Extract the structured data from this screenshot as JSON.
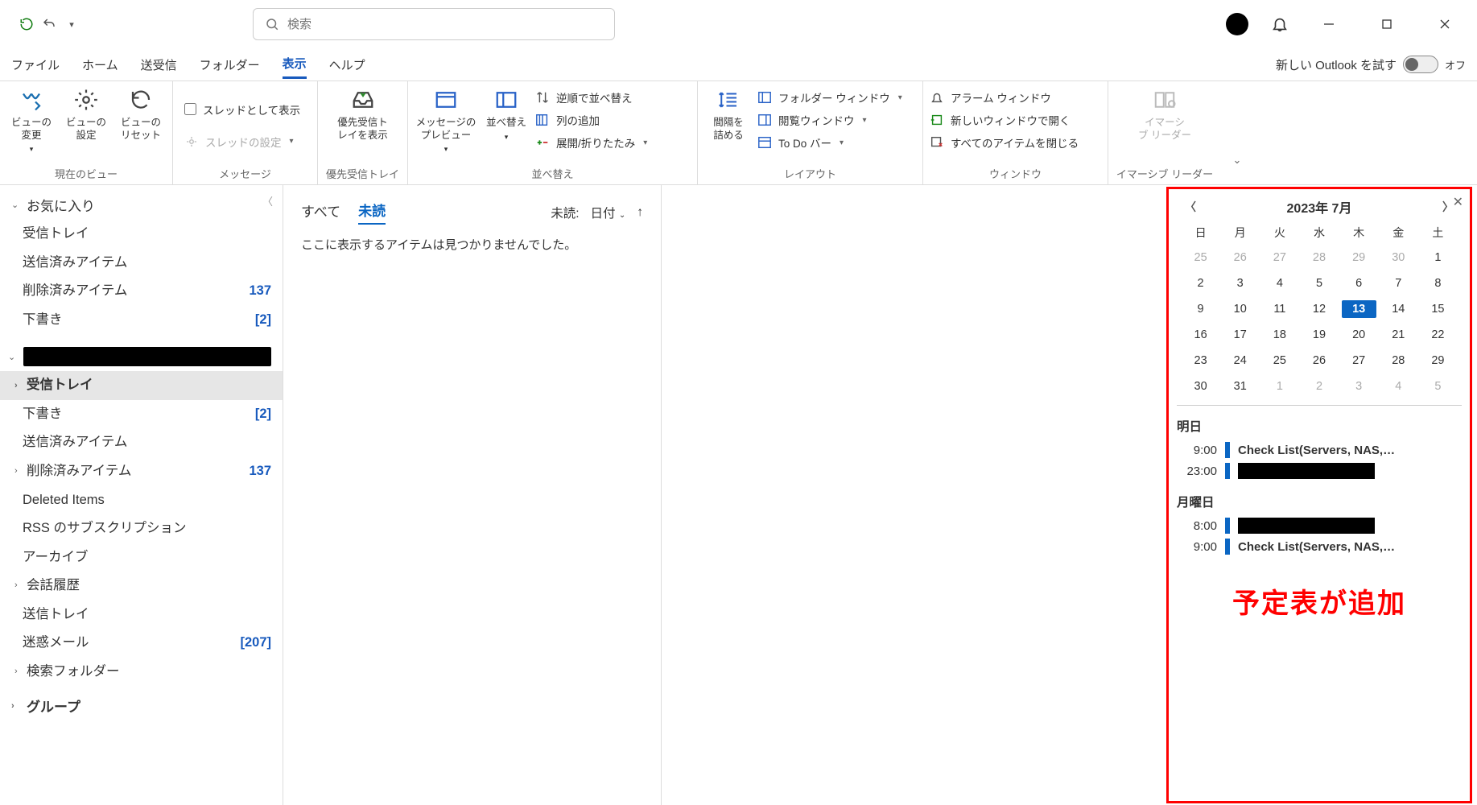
{
  "search": {
    "placeholder": "検索"
  },
  "titlebar": {
    "tryNewOutlook": "新しい Outlook を試す",
    "toggle": "オフ"
  },
  "tabs": [
    "ファイル",
    "ホーム",
    "送受信",
    "フォルダー",
    "表示",
    "ヘルプ"
  ],
  "activeTab": "表示",
  "ribbon": {
    "g1": {
      "label": "現在のビュー",
      "btn1": "ビューの\n変更",
      "btn2": "ビューの\n設定",
      "btn3": "ビューの\nリセット"
    },
    "g2": {
      "label": "メッセージ",
      "thread": "スレッドとして表示",
      "settings": "スレッドの設定"
    },
    "g3": {
      "label": "優先受信トレイ",
      "btn": "優先受信ト\nレイを表示"
    },
    "g4": {
      "label": "並べ替え",
      "preview": "メッセージの\nプレビュー",
      "sort": "並べ替え",
      "reverse": "逆順で並べ替え",
      "addcol": "列の追加",
      "expand": "展開/折りたたみ"
    },
    "g5": {
      "label": "レイアウト",
      "space": "間隔を\n詰める",
      "folder": "フォルダー ウィンドウ",
      "reading": "閲覧ウィンドウ",
      "todo": "To Do バー"
    },
    "g6": {
      "label": "ウィンドウ",
      "alarm": "アラーム ウィンドウ",
      "newwin": "新しいウィンドウで開く",
      "closeall": "すべてのアイテムを閉じる"
    },
    "g7": {
      "label": "イマーシブ リーダー",
      "btn": "イマーシ\nブ リーダー"
    }
  },
  "nav": {
    "favorites": "お気に入り",
    "favItems": [
      {
        "label": "受信トレイ"
      },
      {
        "label": "送信済みアイテム"
      },
      {
        "label": "削除済みアイテム",
        "count": "137"
      },
      {
        "label": "下書き",
        "count": "[2]"
      }
    ],
    "account": "",
    "acctItems": [
      {
        "label": "受信トレイ",
        "sel": true,
        "exp": true
      },
      {
        "label": "下書き",
        "count": "[2]"
      },
      {
        "label": "送信済みアイテム"
      },
      {
        "label": "削除済みアイテム",
        "count": "137",
        "exp": true
      },
      {
        "label": "Deleted Items"
      },
      {
        "label": "RSS のサブスクリプション"
      },
      {
        "label": "アーカイブ"
      },
      {
        "label": "会話履歴",
        "exp": true
      },
      {
        "label": "送信トレイ"
      },
      {
        "label": "迷惑メール",
        "count": "[207]"
      },
      {
        "label": "検索フォルダー",
        "exp": true
      }
    ],
    "groups": "グループ"
  },
  "list": {
    "all": "すべて",
    "unread": "未読",
    "filterUnread": "未読:",
    "filterDate": "日付",
    "empty": "ここに表示するアイテムは見つかりませんでした。"
  },
  "calendar": {
    "title": "2023年 7月",
    "dow": [
      "日",
      "月",
      "火",
      "水",
      "木",
      "金",
      "土"
    ],
    "days": [
      {
        "d": "25",
        "o": true
      },
      {
        "d": "26",
        "o": true
      },
      {
        "d": "27",
        "o": true
      },
      {
        "d": "28",
        "o": true
      },
      {
        "d": "29",
        "o": true
      },
      {
        "d": "30",
        "o": true
      },
      {
        "d": "1"
      },
      {
        "d": "2"
      },
      {
        "d": "3"
      },
      {
        "d": "4"
      },
      {
        "d": "5"
      },
      {
        "d": "6"
      },
      {
        "d": "7"
      },
      {
        "d": "8"
      },
      {
        "d": "9"
      },
      {
        "d": "10"
      },
      {
        "d": "11"
      },
      {
        "d": "12"
      },
      {
        "d": "13",
        "t": true
      },
      {
        "d": "14"
      },
      {
        "d": "15"
      },
      {
        "d": "16"
      },
      {
        "d": "17"
      },
      {
        "d": "18"
      },
      {
        "d": "19"
      },
      {
        "d": "20"
      },
      {
        "d": "21"
      },
      {
        "d": "22"
      },
      {
        "d": "23"
      },
      {
        "d": "24"
      },
      {
        "d": "25"
      },
      {
        "d": "26"
      },
      {
        "d": "27"
      },
      {
        "d": "28"
      },
      {
        "d": "29"
      },
      {
        "d": "30"
      },
      {
        "d": "31"
      },
      {
        "d": "1",
        "o": true
      },
      {
        "d": "2",
        "o": true
      },
      {
        "d": "3",
        "o": true
      },
      {
        "d": "4",
        "o": true
      },
      {
        "d": "5",
        "o": true
      }
    ],
    "sec1": {
      "title": "明日",
      "rows": [
        {
          "t": "9:00",
          "sub": "Check List(Servers, NAS,…"
        },
        {
          "t": "23:00",
          "red": true
        }
      ]
    },
    "sec2": {
      "title": "月曜日",
      "rows": [
        {
          "t": "8:00",
          "red": true
        },
        {
          "t": "9:00",
          "sub": "Check List(Servers, NAS,…"
        }
      ]
    },
    "annotation": "予定表が追加"
  }
}
